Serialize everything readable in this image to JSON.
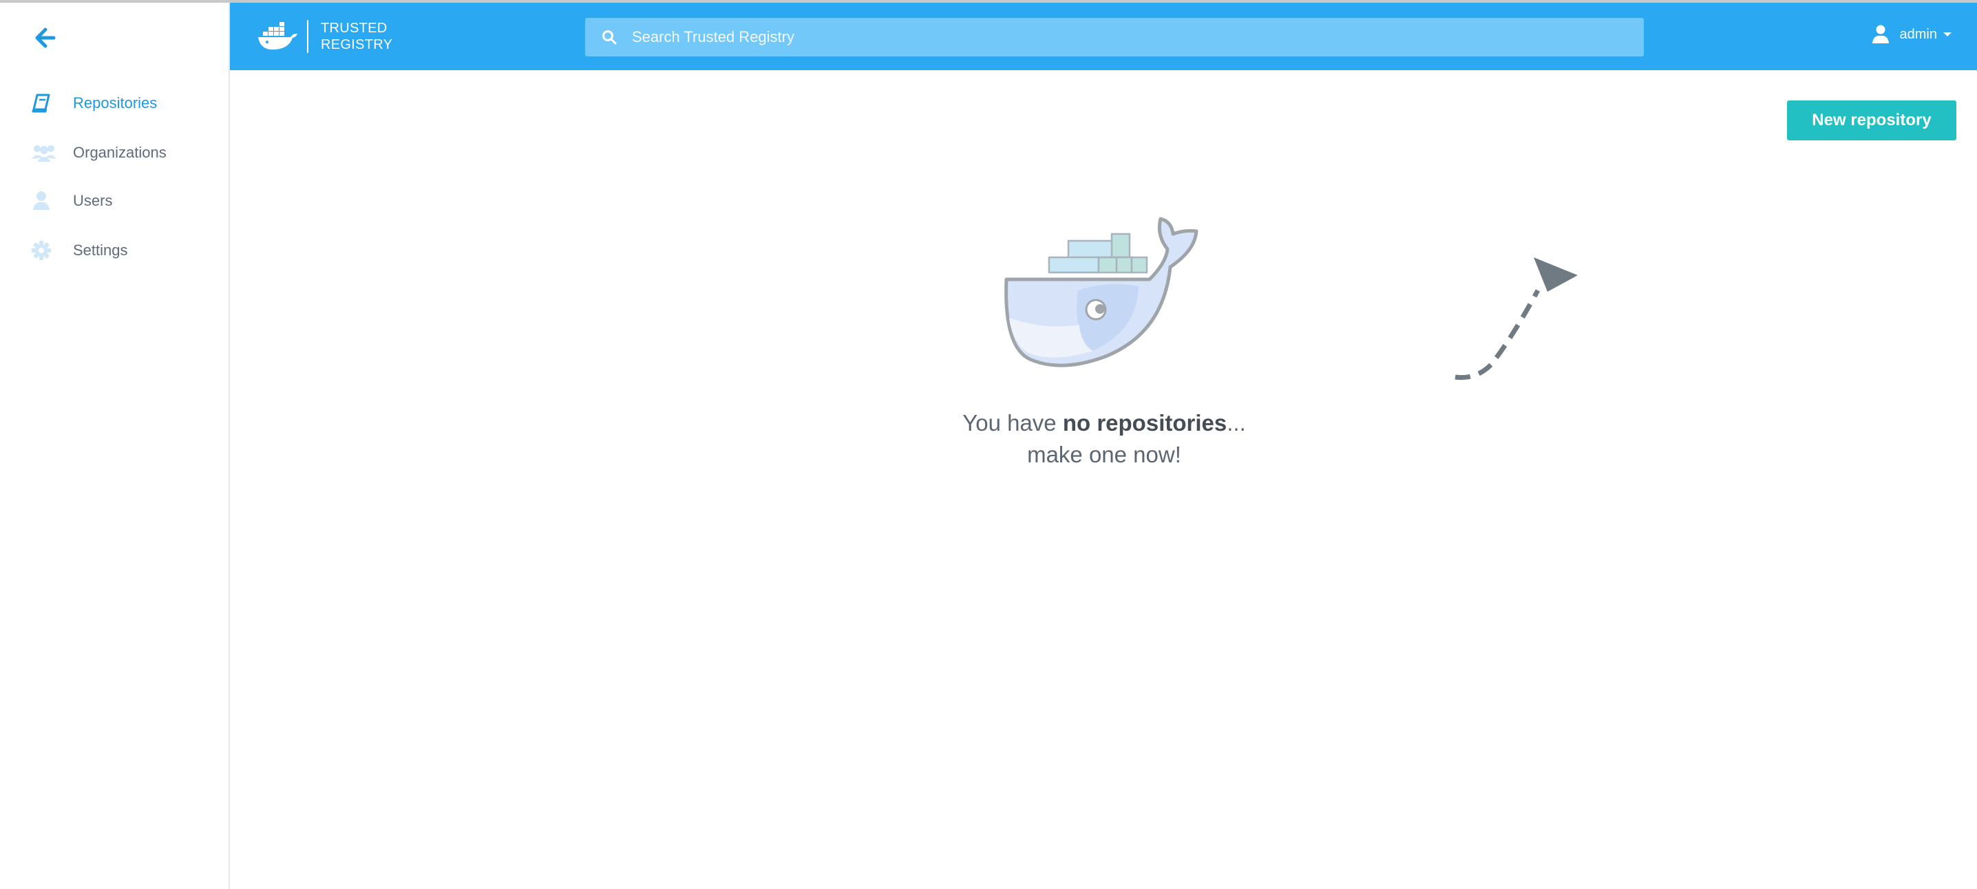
{
  "sidebar": {
    "back_icon": "arrow-left-icon",
    "items": [
      {
        "label": "Repositories",
        "icon": "book-icon",
        "active": true
      },
      {
        "label": "Organizations",
        "icon": "users-group-icon",
        "active": false
      },
      {
        "label": "Users",
        "icon": "user-icon",
        "active": false
      },
      {
        "label": "Settings",
        "icon": "gear-icon",
        "active": false
      }
    ]
  },
  "header": {
    "brand_line1": "TRUSTED",
    "brand_line2": "REGISTRY",
    "search_placeholder": "Search Trusted Registry",
    "username": "admin"
  },
  "main": {
    "new_repo_label": "New repository",
    "empty_prefix": "You have ",
    "empty_bold": "no repositories",
    "empty_suffix": "...",
    "empty_line2": "make one now!"
  },
  "colors": {
    "header_bg": "#2aa8f2",
    "search_bg": "#72c9f9",
    "accent_active": "#1e98df",
    "button_teal": "#22c0c2",
    "nav_text": "#5f6b79"
  }
}
